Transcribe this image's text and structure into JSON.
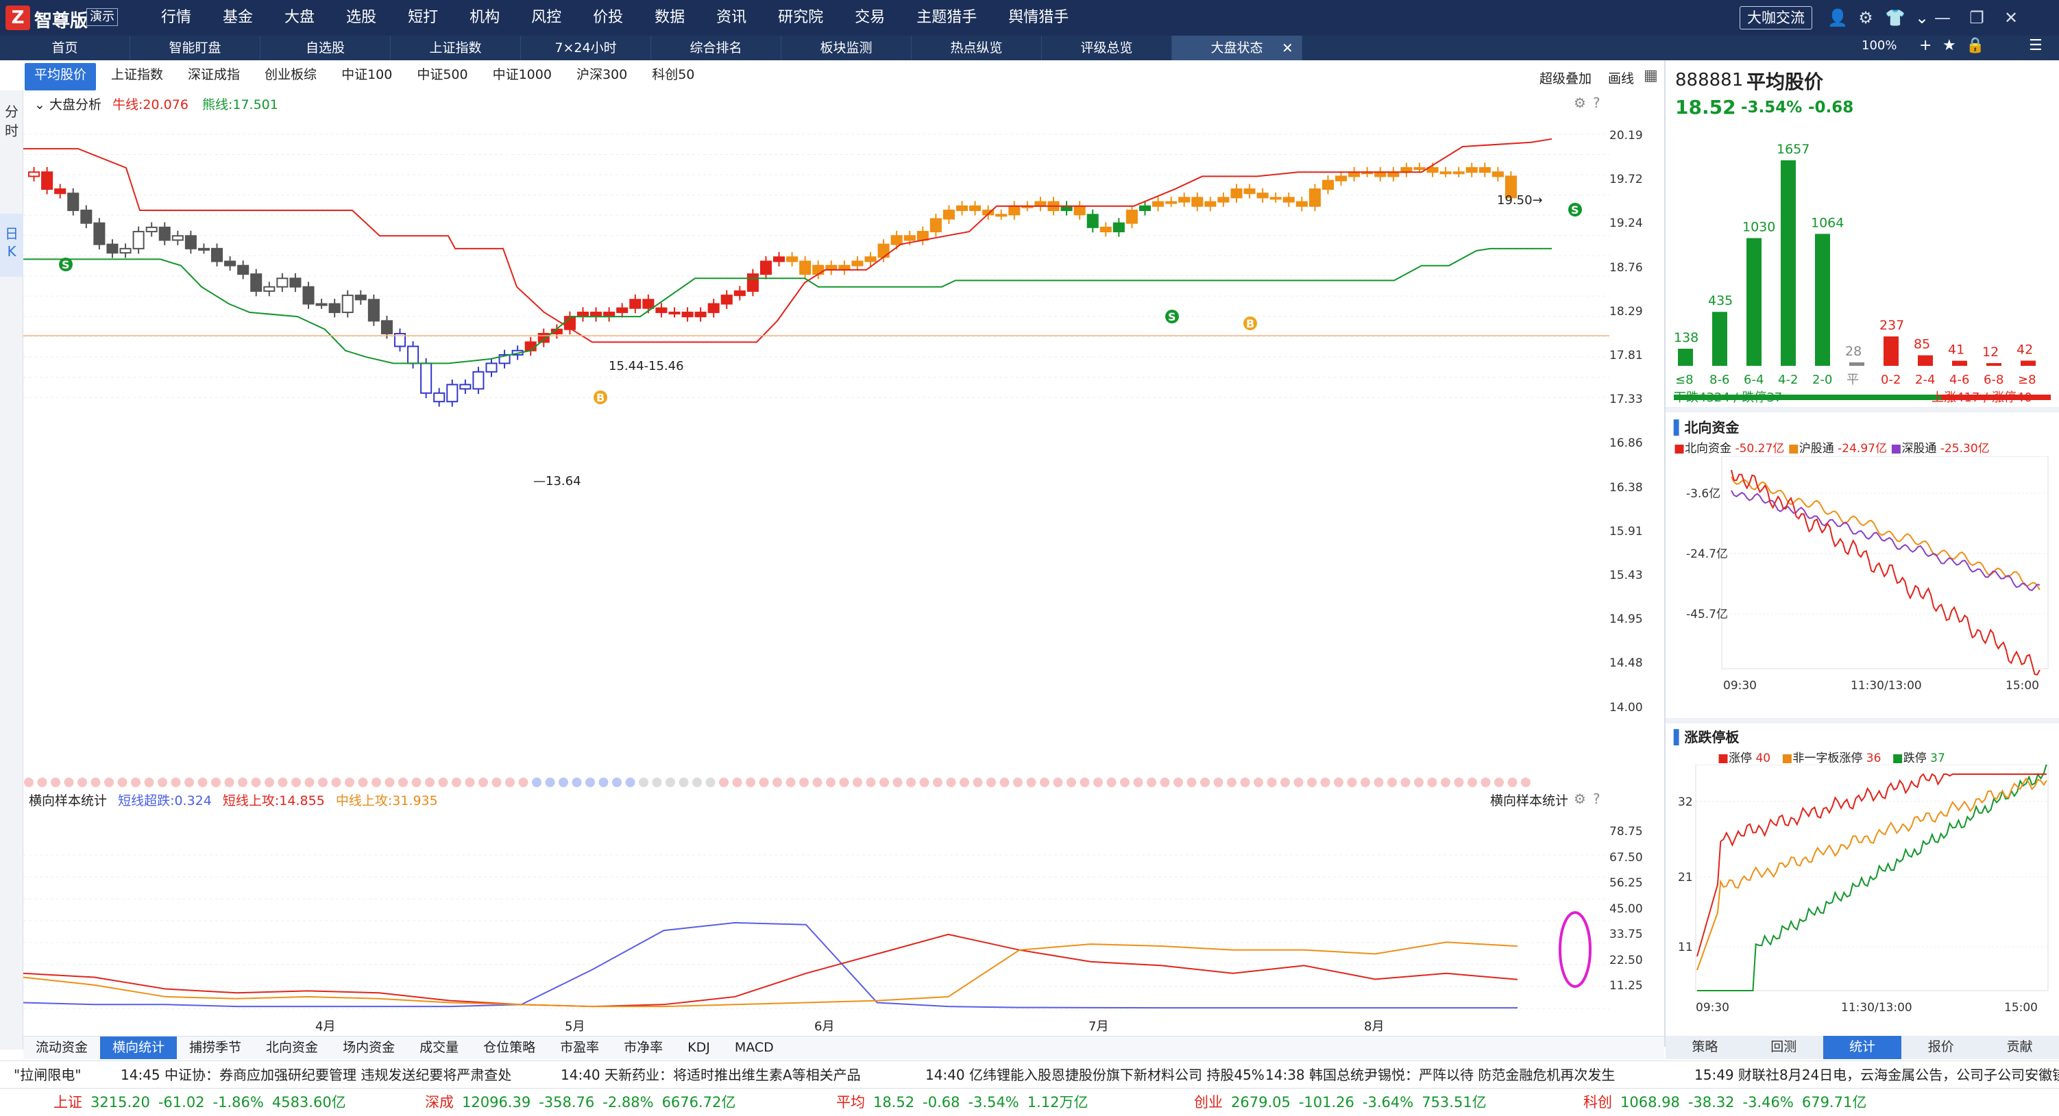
{
  "app": {
    "name": "智尊版",
    "badge": "演示",
    "community_btn": "大咖交流",
    "zoom": "100%"
  },
  "menu": [
    "行情",
    "基金",
    "大盘",
    "选股",
    "短打",
    "机构",
    "风控",
    "价投",
    "数据",
    "资讯",
    "研究院",
    "交易",
    "主题猎手",
    "舆情猎手"
  ],
  "tabs": [
    {
      "label": "首页"
    },
    {
      "label": "智能盯盘"
    },
    {
      "label": "自选股"
    },
    {
      "label": "上证指数"
    },
    {
      "label": "7×24小时"
    },
    {
      "label": "综合排名"
    },
    {
      "label": "板块监测"
    },
    {
      "label": "热点纵览"
    },
    {
      "label": "评级总览"
    },
    {
      "label": "大盘状态",
      "active": true
    }
  ],
  "subtabs": [
    "平均股价",
    "上证指数",
    "深证成指",
    "创业板综",
    "中证100",
    "中证500",
    "中证1000",
    "沪深300",
    "科创50"
  ],
  "subtabs_right": [
    "超级叠加",
    "画线"
  ],
  "left_side": [
    "分",
    "时",
    "日",
    "K"
  ],
  "main_chart": {
    "label": "大盘分析",
    "bull_label": "牛线:20.076",
    "bear_label": "熊线:17.501",
    "price_ticks": [
      "20.19",
      "19.72",
      "19.24",
      "18.76",
      "18.29",
      "17.81",
      "17.33",
      "16.86",
      "16.38",
      "15.91",
      "15.43",
      "14.95",
      "14.48",
      "14.00"
    ],
    "annotations": {
      "high": "19.50",
      "low": "13.64",
      "range": "15.44-15.46"
    },
    "months": [
      "4月",
      "5月",
      "6月",
      "7月",
      "8月"
    ]
  },
  "sub_chart": {
    "label": "横向样本统计",
    "s1": "短线超跌:0.324",
    "s2": "短线上攻:14.855",
    "s3": "中线上攻:31.935",
    "right_label": "横向样本统计",
    "ticks": [
      "78.75",
      "67.50",
      "56.25",
      "45.00",
      "33.75",
      "22.50",
      "11.25"
    ]
  },
  "chart_data": {
    "type": "line",
    "series": [
      {
        "name": "短线超跌",
        "values": [
          3,
          2,
          2,
          1,
          1,
          1,
          1,
          2,
          20,
          40,
          44,
          43,
          3,
          1,
          0.5,
          0.4,
          0.3,
          0.3,
          0.3,
          0.3,
          0.3,
          0.3
        ]
      },
      {
        "name": "短线上攻",
        "values": [
          18,
          16,
          10,
          8,
          9,
          8,
          4,
          2,
          1,
          2,
          6,
          18,
          28,
          38,
          30,
          24,
          22,
          18,
          22,
          15,
          18,
          14.855
        ]
      },
      {
        "name": "中线上攻",
        "values": [
          16,
          12,
          6,
          5,
          6,
          5,
          3,
          2,
          1,
          1,
          2,
          3,
          4,
          6,
          30,
          33,
          32,
          30,
          30,
          28,
          34,
          31.935
        ]
      }
    ]
  },
  "right": {
    "code": "888881",
    "name": "平均股价",
    "price": "18.52",
    "pct": "-3.54%",
    "chg": "-0.68",
    "dist": [
      {
        "v": "138",
        "l": "≤8"
      },
      {
        "v": "435",
        "l": "8-6"
      },
      {
        "v": "1030",
        "l": "6-4"
      },
      {
        "v": "1657",
        "l": "4-2"
      },
      {
        "v": "1064",
        "l": "2-0"
      },
      {
        "v": "28",
        "l": "平"
      },
      {
        "v": "237",
        "l": "0-2"
      },
      {
        "v": "85",
        "l": "2-4"
      },
      {
        "v": "41",
        "l": "4-6"
      },
      {
        "v": "12",
        "l": "6-8"
      },
      {
        "v": "42",
        "l": "≥8"
      }
    ],
    "down_text": "下跌4324 / 跌停37",
    "up_text": "上涨417 / 涨停40",
    "north_title": "北向资金",
    "north_legend": [
      "北向资金",
      "-50.27亿",
      "沪股通",
      "-24.97亿",
      "深股通",
      "-25.30亿"
    ],
    "north_ticks": [
      "-3.6亿",
      "-24.7亿",
      "-45.7亿"
    ],
    "north_x": [
      "09:30",
      "11:30/13:00",
      "15:00"
    ],
    "limit_title": "涨跌停板",
    "limit_legend": [
      "涨停",
      "40",
      "非一字板涨停",
      "36",
      "跌停",
      "37"
    ],
    "limit_ticks": [
      "32",
      "21",
      "11"
    ],
    "limit_x": [
      "09:30",
      "11:30/13:00",
      "15:00"
    ]
  },
  "bottom_tabs": [
    "流动资金",
    "横向统计",
    "捕捞季节",
    "北向资金",
    "场内资金",
    "成交量",
    "仓位策略",
    "市盈率",
    "市净率",
    "KDJ",
    "MACD"
  ],
  "right_tabs": [
    "策略",
    "回测",
    "统计",
    "报价",
    "贡献"
  ],
  "news": [
    "\"拉闸限电\"",
    "14:45 中证协：券商应加强研纪要管理 违规发送纪要将严肃查处",
    "14:40 天新药业：将适时推出维生素A等相关产品",
    "14:40 亿纬锂能入股恩捷股份旗下新材料公司 持股45%",
    "14:38 韩国总统尹锡悦：严阵以待 防范金融危机再次发生",
    "15:49 财联社8月24日电，云海金属公告，公司子公司安徽镁"
  ],
  "status": [
    {
      "name": "上证",
      "v": "3215.20",
      "c": "-61.02",
      "p": "-1.86%",
      "a": "4583.60亿"
    },
    {
      "name": "深成",
      "v": "12096.39",
      "c": "-358.76",
      "p": "-2.88%",
      "a": "6676.72亿"
    },
    {
      "name": "平均",
      "v": "18.52",
      "c": "-0.68",
      "p": "-3.54%",
      "a": "1.12万亿"
    },
    {
      "name": "创业",
      "v": "2679.05",
      "c": "-101.26",
      "p": "-3.64%",
      "a": "753.51亿"
    },
    {
      "name": "科创",
      "v": "1068.98",
      "c": "-38.32",
      "p": "-3.46%",
      "a": "679.71亿"
    }
  ]
}
